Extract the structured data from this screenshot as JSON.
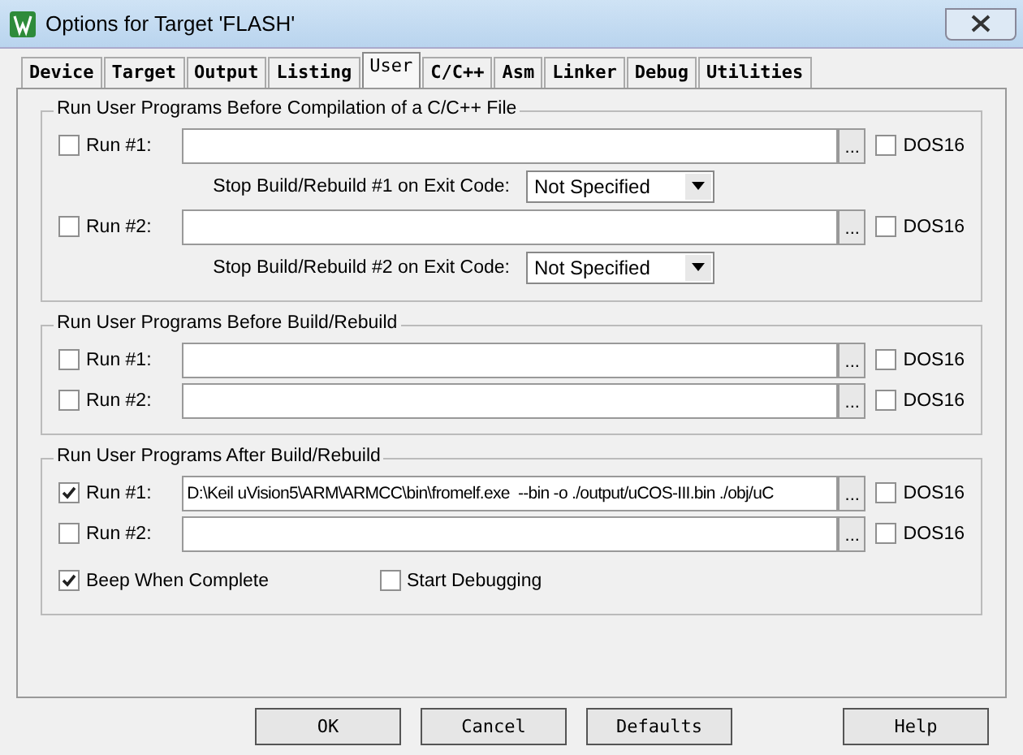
{
  "window": {
    "title": "Options for Target 'FLASH'"
  },
  "tabs": [
    {
      "label": "Device",
      "selected": false
    },
    {
      "label": "Target",
      "selected": false
    },
    {
      "label": "Output",
      "selected": false
    },
    {
      "label": "Listing",
      "selected": false
    },
    {
      "label": "User",
      "selected": true
    },
    {
      "label": "C/C++",
      "selected": false
    },
    {
      "label": "Asm",
      "selected": false
    },
    {
      "label": "Linker",
      "selected": false
    },
    {
      "label": "Debug",
      "selected": false
    },
    {
      "label": "Utilities",
      "selected": false
    }
  ],
  "groups": [
    {
      "title": "Run User Programs Before Compilation of a C/C++ File",
      "rows": [
        {
          "kind": "run",
          "checked": false,
          "label": "Run #1:",
          "browse": "...",
          "dos16": {
            "label": "DOS16",
            "checked": false
          }
        },
        {
          "kind": "exit",
          "label": "Stop Build/Rebuild #1 on Exit Code:",
          "value": "Not Specified"
        },
        {
          "kind": "run",
          "checked": false,
          "label": "Run #2:",
          "browse": "...",
          "dos16": {
            "label": "DOS16",
            "checked": false
          }
        },
        {
          "kind": "exit",
          "label": "Stop Build/Rebuild #2 on Exit Code:",
          "value": "Not Specified"
        }
      ]
    },
    {
      "title": "Run User Programs Before Build/Rebuild",
      "rows": [
        {
          "kind": "run",
          "checked": false,
          "label": "Run #1:",
          "browse": "...",
          "dos16": {
            "label": "DOS16",
            "checked": false
          }
        },
        {
          "kind": "run",
          "checked": false,
          "label": "Run #2:",
          "browse": "...",
          "dos16": {
            "label": "DOS16",
            "checked": false
          }
        }
      ]
    },
    {
      "title": "Run User Programs After Build/Rebuild",
      "rows": [
        {
          "kind": "run",
          "checked": true,
          "label": "Run #1:",
          "value": "D:\\Keil uVision5\\ARM\\ARMCC\\bin\\fromelf.exe  --bin -o ./output/uCOS-III.bin ./obj/uC",
          "browse": "...",
          "dos16": {
            "label": "DOS16",
            "checked": false
          }
        },
        {
          "kind": "run",
          "checked": false,
          "label": "Run #2:",
          "browse": "...",
          "dos16": {
            "label": "DOS16",
            "checked": false
          }
        },
        {
          "kind": "options",
          "items": [
            {
              "label": "Beep When Complete",
              "checked": true
            },
            {
              "label": "Start Debugging",
              "checked": false
            }
          ]
        }
      ]
    }
  ],
  "buttons": [
    "OK",
    "Cancel",
    "Defaults",
    "Help"
  ]
}
